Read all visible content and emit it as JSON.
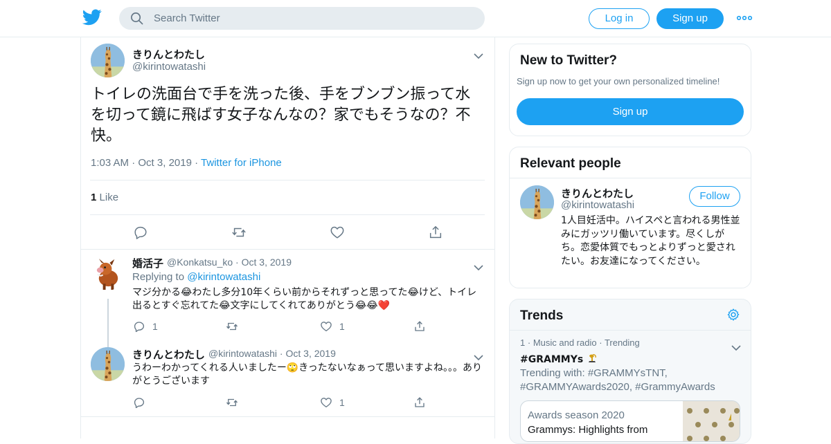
{
  "header": {
    "search_placeholder": "Search Twitter",
    "login_label": "Log in",
    "signup_label": "Sign up",
    "brand_color": "#1da1f2"
  },
  "tweet": {
    "name": "きりんとわたし",
    "handle": "@kirintowatashi",
    "text": "トイレの洗面台で手を洗った後、手をブンブン振って水を切って鏡に飛ばす女子なんなの？家でもそうなの？不快。",
    "time": "1:03 AM",
    "date": "Oct 3, 2019",
    "source": "Twitter for iPhone",
    "like_count": "1",
    "like_label": "Like"
  },
  "replies": [
    {
      "name": "婚活子",
      "handle": "@Konkatsu_ko",
      "date": "Oct 3, 2019",
      "replying_label": "Replying to",
      "replying_to": "@kirintowatashi",
      "text": "マジ分かる😂わたし多分10年くらい前からそれずっと思ってた😂けど、トイレ出るとすぐ忘れてた😂文字にしてくれてありがとう😂😂❤️",
      "reply_count": "1",
      "like_count": "1"
    },
    {
      "name": "きりんとわたし",
      "handle": "@kirintowatashi",
      "date": "Oct 3, 2019",
      "text": "うわーわかってくれる人いましたー🙄きったないなぁって思いますよね。。。ありがとうございます",
      "reply_count": "",
      "like_count": "1"
    }
  ],
  "sidebar": {
    "new": {
      "title": "New to Twitter?",
      "subtitle": "Sign up now to get your own personalized timeline!",
      "button": "Sign up"
    },
    "relevant": {
      "title": "Relevant people",
      "name": "きりんとわたし",
      "handle": "@kirintowatashi",
      "follow": "Follow",
      "bio": "1人目妊活中。ハイスペと言われる男性並みにガッツリ働いています。尽くしがち。恋愛体質でもっとよりずっと愛されたい。お友達になってください。"
    },
    "trends": {
      "title": "Trends",
      "rank": "1",
      "category": "Music and radio",
      "status": "Trending",
      "name": "#GRAMMYs",
      "with_text": "Trending with: #GRAMMYsTNT, #GRAMMYAwards2020, #GrammyAwards",
      "moment_category": "Awards season 2020",
      "moment_title": "Grammys: Highlights from"
    }
  }
}
